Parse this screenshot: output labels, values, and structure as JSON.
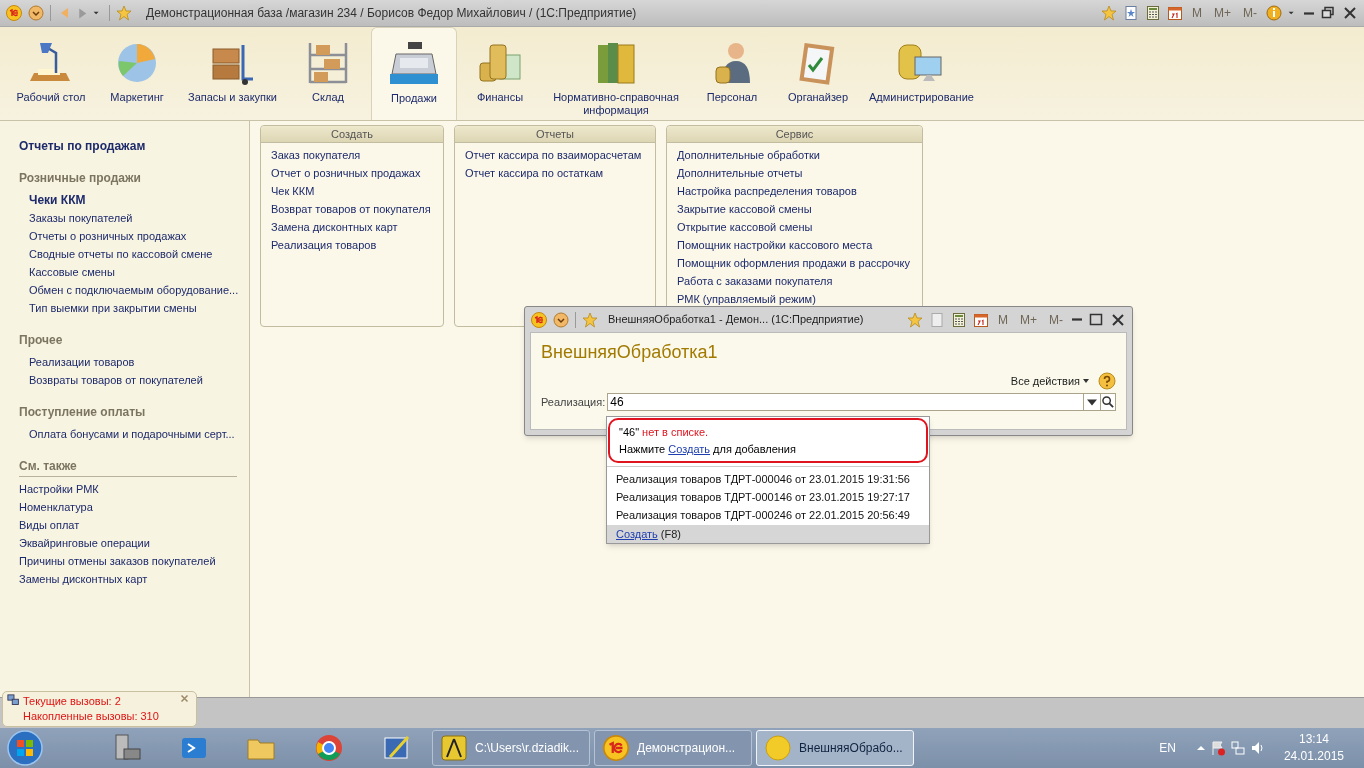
{
  "window": {
    "title": "Демонстрационная база /магазин 234 / Борисов Федор Михайлович /  (1С:Предприятие)",
    "memory_buttons": [
      "M",
      "M+",
      "M-"
    ]
  },
  "sections": [
    {
      "label": "Рабочий стол",
      "selected": false
    },
    {
      "label": "Маркетинг",
      "selected": false
    },
    {
      "label": "Запасы и закупки",
      "selected": false
    },
    {
      "label": "Склад",
      "selected": false
    },
    {
      "label": "Продажи",
      "selected": true
    },
    {
      "label": "Финансы",
      "selected": false
    },
    {
      "label": "Нормативно-справочная информация",
      "selected": false
    },
    {
      "label": "Персонал",
      "selected": false
    },
    {
      "label": "Органайзер",
      "selected": false
    },
    {
      "label": "Администрирование",
      "selected": false
    }
  ],
  "left_panel": {
    "title": "Отчеты по продажам",
    "groups": [
      {
        "title": "Розничные продажи",
        "items": [
          {
            "label": "Чеки ККМ",
            "selected": true
          },
          {
            "label": "Заказы покупателей",
            "selected": false
          },
          {
            "label": "Отчеты о розничных продажах",
            "selected": false
          },
          {
            "label": "Сводные отчеты по кассовой смене",
            "selected": false
          },
          {
            "label": "Кассовые смены",
            "selected": false
          },
          {
            "label": "Обмен с подключаемым оборудование...",
            "selected": false
          },
          {
            "label": "Тип выемки при закрытии смены",
            "selected": false
          }
        ]
      },
      {
        "title": "Прочее",
        "items": [
          {
            "label": "Реализации товаров",
            "selected": false
          },
          {
            "label": "Возвраты товаров от покупателей",
            "selected": false
          }
        ]
      },
      {
        "title": "Поступление оплаты",
        "items": [
          {
            "label": "Оплата бонусами и подарочными серт...",
            "selected": false
          }
        ]
      }
    ],
    "see_also": {
      "title": "См. также",
      "items": [
        "Настройки РМК",
        "Номенклатура",
        "Виды оплат",
        "Эквайринговые операции",
        "Причины отмены заказов покупателей",
        "Замены дисконтных карт"
      ]
    }
  },
  "command_panels": [
    {
      "title": "Создать",
      "items": [
        "Заказ покупателя",
        "Отчет о розничных продажах",
        "Чек ККМ",
        "Возврат товаров от покупателя",
        "Замена дисконтных карт",
        "Реализация товаров"
      ]
    },
    {
      "title": "Отчеты",
      "items": [
        "Отчет кассира по взаиморасчетам",
        "Отчет кассира по остаткам"
      ]
    },
    {
      "title": "Сервис",
      "items": [
        "Дополнительные обработки",
        "Дополнительные отчеты",
        "Настройка распределения товаров",
        "Закрытие кассовой смены",
        "Открытие кассовой смены",
        "Помощник настройки кассового места",
        "Помощник оформления продажи в рассрочку",
        "Работа с заказами покупателя",
        "РМК (управляемый режим)"
      ]
    }
  ],
  "dialog": {
    "title": "ВнешняяОбработка1 - Демон...  (1С:Предприятие)",
    "memory_buttons": [
      "M",
      "M+",
      "M-"
    ],
    "heading": "ВнешняяОбработка1",
    "all_actions": "Все действия",
    "field": {
      "label": "Реализация:",
      "value": "46"
    }
  },
  "dropdown": {
    "value_quoted": "\"46\"",
    "warning": "нет в списке.",
    "hint_before": "Нажмите",
    "hint_link": "Создать",
    "hint_after": "для добавления",
    "items": [
      "Реализация товаров ТДРТ-000046 от 23.01.2015 19:31:56",
      "Реализация товаров ТДРТ-000146 от 23.01.2015 19:27:17",
      "Реализация товаров ТДРТ-000246 от 22.01.2015 20:56:49"
    ],
    "footer_link": "Создать",
    "footer_shortcut": "(F8)"
  },
  "calls_popup": {
    "lines": [
      "Текущие вызовы: 2",
      "Накопленные вызовы: 310"
    ]
  },
  "taskbar": {
    "windows": [
      {
        "label": "C:\\Users\\r.dziadik...",
        "selected": false
      },
      {
        "label": "Демонстрацион...",
        "selected": false
      },
      {
        "label": "ВнешняяОбрабо...",
        "selected": true
      }
    ],
    "language": "EN",
    "time": "13:14",
    "date": "24.01.2015"
  }
}
